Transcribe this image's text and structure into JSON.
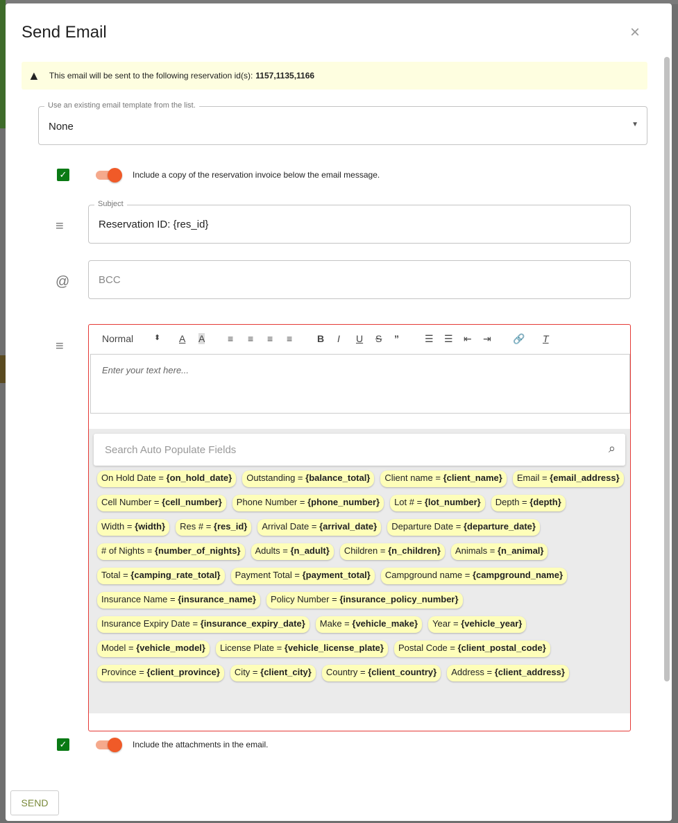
{
  "dialog": {
    "title": "Send Email",
    "close": "×"
  },
  "alert": {
    "text": "This email will be sent to the following reservation id(s):",
    "ids": "1157,1135,1166"
  },
  "template": {
    "label": "Use an existing email template from the list.",
    "value": "None"
  },
  "invoice": {
    "checked": true,
    "label": "Include a copy of the reservation invoice below the email message."
  },
  "subject": {
    "label": "Subject",
    "value": "Reservation ID: {res_id}"
  },
  "bcc": {
    "placeholder": "BCC"
  },
  "editor": {
    "format": "Normal",
    "placeholder": "Enter your text here..."
  },
  "search": {
    "placeholder": "Search Auto Populate Fields"
  },
  "chips": [
    {
      "label": "On Hold Date =",
      "field": "{on_hold_date}"
    },
    {
      "label": "Outstanding =",
      "field": "{balance_total}"
    },
    {
      "label": "Client name =",
      "field": "{client_name}"
    },
    {
      "label": "Email =",
      "field": "{email_address}"
    },
    {
      "label": "Cell Number =",
      "field": "{cell_number}"
    },
    {
      "label": "Phone Number =",
      "field": "{phone_number}"
    },
    {
      "label": "Lot # =",
      "field": "{lot_number}"
    },
    {
      "label": "Depth =",
      "field": "{depth}"
    },
    {
      "label": "Width =",
      "field": "{width}"
    },
    {
      "label": "Res # =",
      "field": "{res_id}"
    },
    {
      "label": "Arrival Date =",
      "field": "{arrival_date}"
    },
    {
      "label": "Departure Date =",
      "field": "{departure_date}"
    },
    {
      "label": "# of Nights =",
      "field": "{number_of_nights}"
    },
    {
      "label": "Adults =",
      "field": "{n_adult}"
    },
    {
      "label": "Children =",
      "field": "{n_children}"
    },
    {
      "label": "Animals =",
      "field": "{n_animal}"
    },
    {
      "label": "Total =",
      "field": "{camping_rate_total}"
    },
    {
      "label": "Payment Total =",
      "field": "{payment_total}"
    },
    {
      "label": "Campground name =",
      "field": "{campground_name}"
    },
    {
      "label": "Insurance Name =",
      "field": "{insurance_name}"
    },
    {
      "label": "Policy Number =",
      "field": "{insurance_policy_number}"
    },
    {
      "label": "Insurance Expiry Date =",
      "field": "{insurance_expiry_date}"
    },
    {
      "label": "Make =",
      "field": "{vehicle_make}"
    },
    {
      "label": "Year =",
      "field": "{vehicle_year}"
    },
    {
      "label": "Model =",
      "field": "{vehicle_model}"
    },
    {
      "label": "License Plate =",
      "field": "{vehicle_license_plate}"
    },
    {
      "label": "Postal Code =",
      "field": "{client_postal_code}"
    },
    {
      "label": "Province =",
      "field": "{client_province}"
    },
    {
      "label": "City =",
      "field": "{client_city}"
    },
    {
      "label": "Country =",
      "field": "{client_country}"
    },
    {
      "label": "Address =",
      "field": "{client_address}"
    }
  ],
  "attachments": {
    "checked": true,
    "label": "Include the attachments in the email."
  },
  "send": "SEND",
  "colors": {
    "accent": "#f05a28",
    "check": "#0a7a14",
    "chip": "#fefeb9",
    "alert_bg": "#fefee0",
    "editor_border": "#e53935"
  }
}
